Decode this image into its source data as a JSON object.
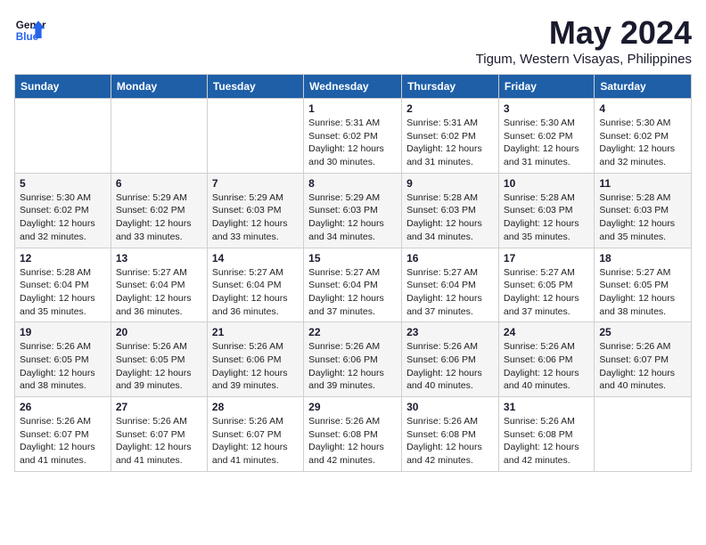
{
  "logo": {
    "line1": "General",
    "line2": "Blue"
  },
  "header": {
    "month": "May 2024",
    "location": "Tigum, Western Visayas, Philippines"
  },
  "weekdays": [
    "Sunday",
    "Monday",
    "Tuesday",
    "Wednesday",
    "Thursday",
    "Friday",
    "Saturday"
  ],
  "weeks": [
    [
      {
        "day": "",
        "info": ""
      },
      {
        "day": "",
        "info": ""
      },
      {
        "day": "",
        "info": ""
      },
      {
        "day": "1",
        "info": "Sunrise: 5:31 AM\nSunset: 6:02 PM\nDaylight: 12 hours\nand 30 minutes."
      },
      {
        "day": "2",
        "info": "Sunrise: 5:31 AM\nSunset: 6:02 PM\nDaylight: 12 hours\nand 31 minutes."
      },
      {
        "day": "3",
        "info": "Sunrise: 5:30 AM\nSunset: 6:02 PM\nDaylight: 12 hours\nand 31 minutes."
      },
      {
        "day": "4",
        "info": "Sunrise: 5:30 AM\nSunset: 6:02 PM\nDaylight: 12 hours\nand 32 minutes."
      }
    ],
    [
      {
        "day": "5",
        "info": "Sunrise: 5:30 AM\nSunset: 6:02 PM\nDaylight: 12 hours\nand 32 minutes."
      },
      {
        "day": "6",
        "info": "Sunrise: 5:29 AM\nSunset: 6:02 PM\nDaylight: 12 hours\nand 33 minutes."
      },
      {
        "day": "7",
        "info": "Sunrise: 5:29 AM\nSunset: 6:03 PM\nDaylight: 12 hours\nand 33 minutes."
      },
      {
        "day": "8",
        "info": "Sunrise: 5:29 AM\nSunset: 6:03 PM\nDaylight: 12 hours\nand 34 minutes."
      },
      {
        "day": "9",
        "info": "Sunrise: 5:28 AM\nSunset: 6:03 PM\nDaylight: 12 hours\nand 34 minutes."
      },
      {
        "day": "10",
        "info": "Sunrise: 5:28 AM\nSunset: 6:03 PM\nDaylight: 12 hours\nand 35 minutes."
      },
      {
        "day": "11",
        "info": "Sunrise: 5:28 AM\nSunset: 6:03 PM\nDaylight: 12 hours\nand 35 minutes."
      }
    ],
    [
      {
        "day": "12",
        "info": "Sunrise: 5:28 AM\nSunset: 6:04 PM\nDaylight: 12 hours\nand 35 minutes."
      },
      {
        "day": "13",
        "info": "Sunrise: 5:27 AM\nSunset: 6:04 PM\nDaylight: 12 hours\nand 36 minutes."
      },
      {
        "day": "14",
        "info": "Sunrise: 5:27 AM\nSunset: 6:04 PM\nDaylight: 12 hours\nand 36 minutes."
      },
      {
        "day": "15",
        "info": "Sunrise: 5:27 AM\nSunset: 6:04 PM\nDaylight: 12 hours\nand 37 minutes."
      },
      {
        "day": "16",
        "info": "Sunrise: 5:27 AM\nSunset: 6:04 PM\nDaylight: 12 hours\nand 37 minutes."
      },
      {
        "day": "17",
        "info": "Sunrise: 5:27 AM\nSunset: 6:05 PM\nDaylight: 12 hours\nand 37 minutes."
      },
      {
        "day": "18",
        "info": "Sunrise: 5:27 AM\nSunset: 6:05 PM\nDaylight: 12 hours\nand 38 minutes."
      }
    ],
    [
      {
        "day": "19",
        "info": "Sunrise: 5:26 AM\nSunset: 6:05 PM\nDaylight: 12 hours\nand 38 minutes."
      },
      {
        "day": "20",
        "info": "Sunrise: 5:26 AM\nSunset: 6:05 PM\nDaylight: 12 hours\nand 39 minutes."
      },
      {
        "day": "21",
        "info": "Sunrise: 5:26 AM\nSunset: 6:06 PM\nDaylight: 12 hours\nand 39 minutes."
      },
      {
        "day": "22",
        "info": "Sunrise: 5:26 AM\nSunset: 6:06 PM\nDaylight: 12 hours\nand 39 minutes."
      },
      {
        "day": "23",
        "info": "Sunrise: 5:26 AM\nSunset: 6:06 PM\nDaylight: 12 hours\nand 40 minutes."
      },
      {
        "day": "24",
        "info": "Sunrise: 5:26 AM\nSunset: 6:06 PM\nDaylight: 12 hours\nand 40 minutes."
      },
      {
        "day": "25",
        "info": "Sunrise: 5:26 AM\nSunset: 6:07 PM\nDaylight: 12 hours\nand 40 minutes."
      }
    ],
    [
      {
        "day": "26",
        "info": "Sunrise: 5:26 AM\nSunset: 6:07 PM\nDaylight: 12 hours\nand 41 minutes."
      },
      {
        "day": "27",
        "info": "Sunrise: 5:26 AM\nSunset: 6:07 PM\nDaylight: 12 hours\nand 41 minutes."
      },
      {
        "day": "28",
        "info": "Sunrise: 5:26 AM\nSunset: 6:07 PM\nDaylight: 12 hours\nand 41 minutes."
      },
      {
        "day": "29",
        "info": "Sunrise: 5:26 AM\nSunset: 6:08 PM\nDaylight: 12 hours\nand 42 minutes."
      },
      {
        "day": "30",
        "info": "Sunrise: 5:26 AM\nSunset: 6:08 PM\nDaylight: 12 hours\nand 42 minutes."
      },
      {
        "day": "31",
        "info": "Sunrise: 5:26 AM\nSunset: 6:08 PM\nDaylight: 12 hours\nand 42 minutes."
      },
      {
        "day": "",
        "info": ""
      }
    ]
  ]
}
